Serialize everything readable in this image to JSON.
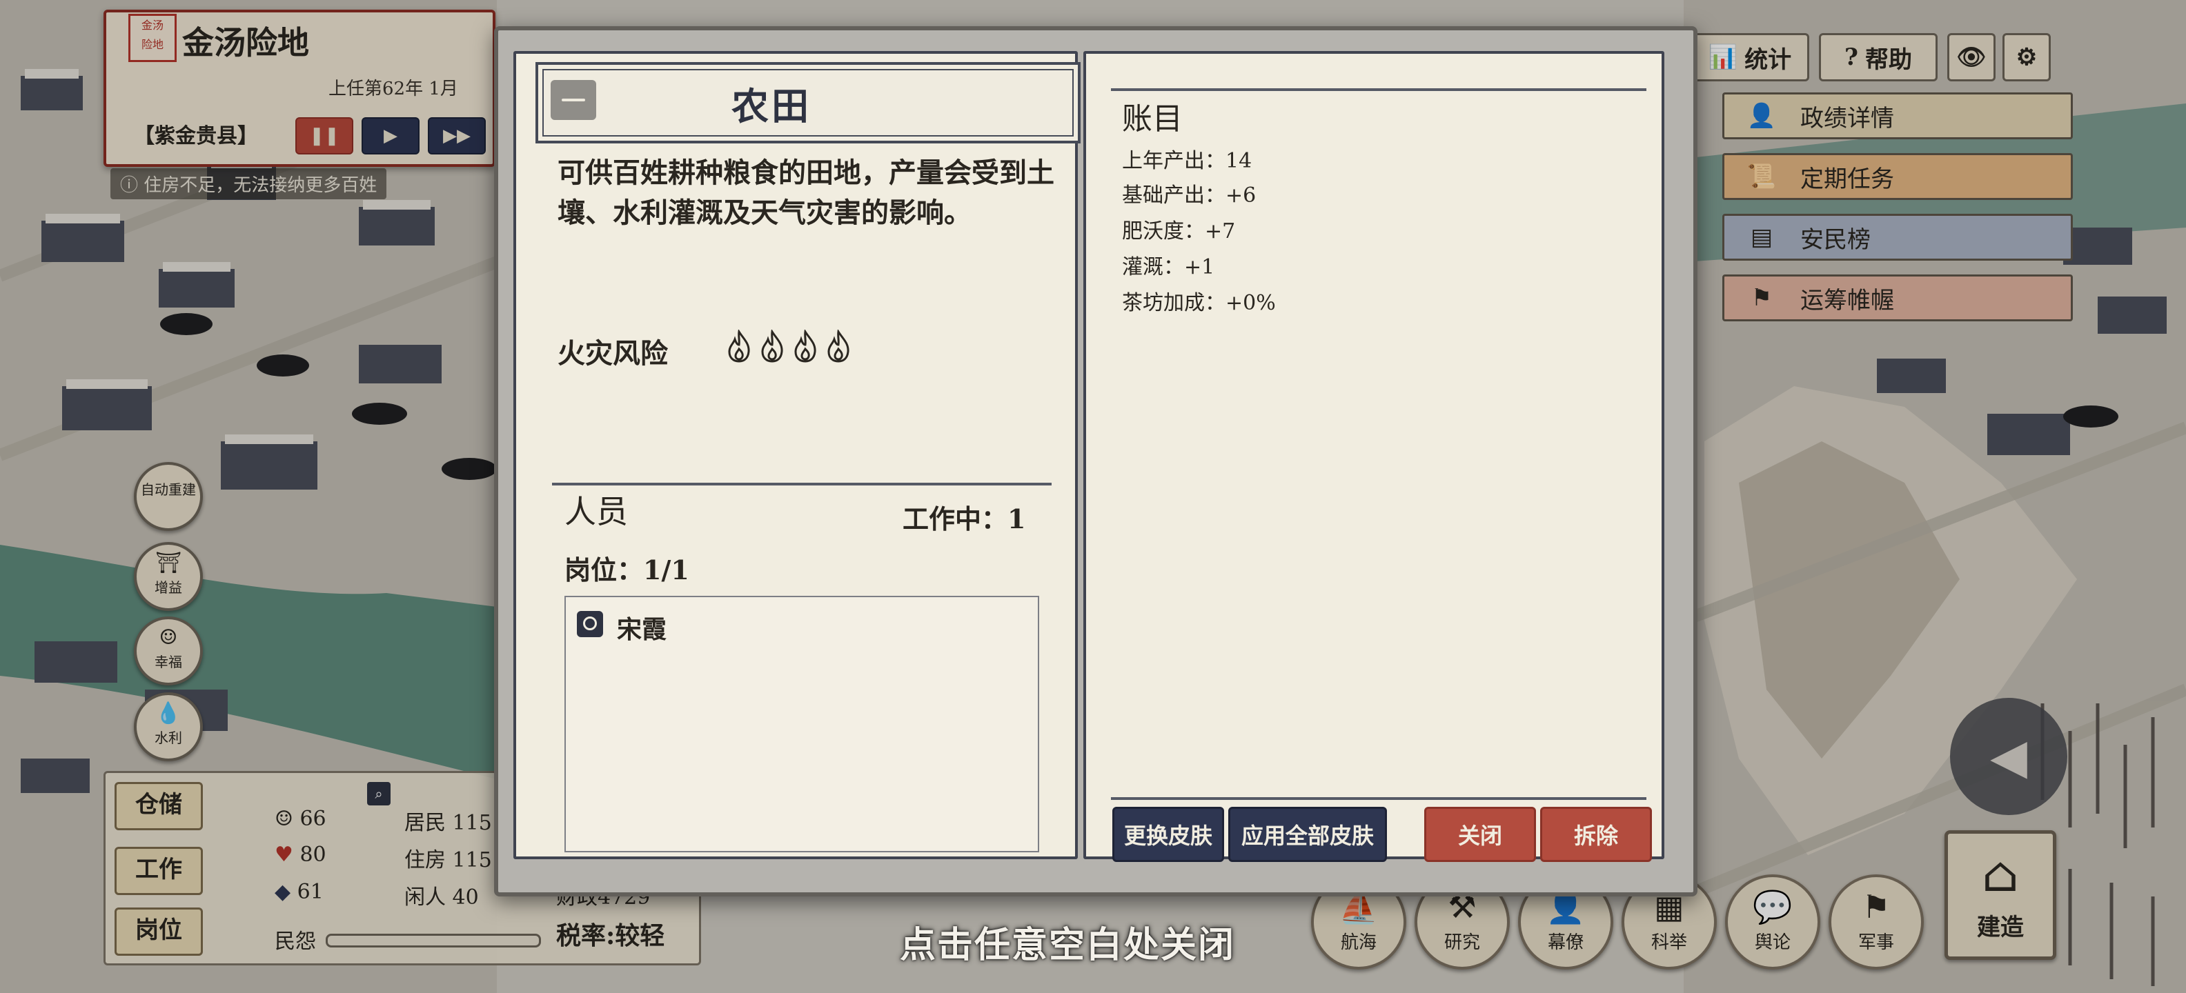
{
  "top_left": {
    "seal_text": "金汤险地",
    "city_name": "金汤险地",
    "term": "上任第62年 1月",
    "county": "【紫金贵县】",
    "notice": "住房不足，无法接纳更多百姓",
    "speed_buttons": [
      "pause",
      "play",
      "fast-forward"
    ]
  },
  "left_buttons": [
    {
      "label": "自动重建",
      "icon": "rebuild-icon"
    },
    {
      "label": "增益",
      "icon": "temple-icon"
    },
    {
      "label": "幸福",
      "icon": "face-icon"
    },
    {
      "label": "水利",
      "icon": "water-drop-icon"
    }
  ],
  "bottom_left": {
    "buttons": [
      "仓储",
      "工作",
      "岗位"
    ],
    "stats": {
      "happiness": "66",
      "health": "80",
      "hat": "61"
    },
    "residents": "居民 115",
    "housing": "住房 115",
    "idle": "闲人 40",
    "finance": "财政4729",
    "resentment_label": "民怨",
    "tax": "税率:较轻"
  },
  "top_right": {
    "stats_label": "统计",
    "help_label": "帮助",
    "eye_icon": "eye-icon",
    "gear_icon": "gear-icon"
  },
  "right_menu": [
    {
      "label": "政绩详情",
      "icon": "official-icon",
      "bg": "#e2d4b3"
    },
    {
      "label": "定期任务",
      "icon": "scroll-icon",
      "bg": "#e3b683"
    },
    {
      "label": "安民榜",
      "icon": "board-icon",
      "bg": "#aab3c4"
    },
    {
      "label": "运筹帷幄",
      "icon": "flag-icon",
      "bg": "#e0b29f"
    }
  ],
  "bottom_buttons": [
    "航海",
    "研究",
    "幕僚",
    "科举",
    "舆论",
    "军事"
  ],
  "build_label": "建造",
  "modal": {
    "title": "农田",
    "description": "可供百姓耕种粮食的田地，产量会受到土壤、水利灌溉及天气灾害的影响。",
    "fire_risk_label": "火灾风险",
    "fire_risk_level": 4,
    "staff_heading": "人员",
    "working": "工作中：1",
    "post": "岗位：1/1",
    "staff": [
      "宋霞"
    ],
    "account_heading": "账目",
    "account_lines": [
      "上年产出：14",
      "基础产出：+6",
      "肥沃度：+7",
      "灌溉：+1",
      "茶坊加成：+0%"
    ],
    "buttons": {
      "change_skin": "更换皮肤",
      "apply_all_skin": "应用全部皮肤",
      "close": "关闭",
      "demolish": "拆除"
    }
  },
  "close_hint": "点击任意空白处关闭"
}
